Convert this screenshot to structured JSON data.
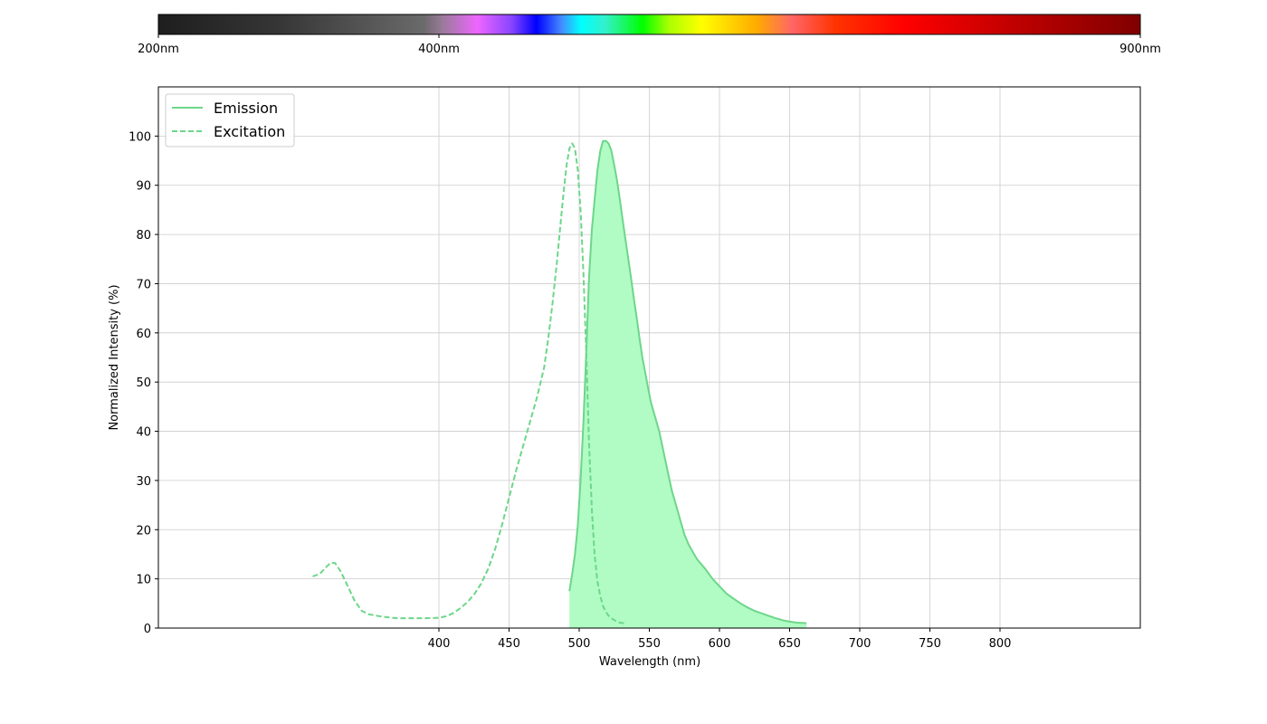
{
  "spectrum_bar": {
    "labels": [
      {
        "wavelength": 200,
        "text": "200nm"
      },
      {
        "wavelength": 400,
        "text": "400nm"
      },
      {
        "wavelength": 900,
        "text": "900nm"
      }
    ],
    "range": [
      200,
      900
    ]
  },
  "chart_data": {
    "type": "line",
    "title": "",
    "xlabel": "Wavelength (nm)",
    "ylabel": "Normalized Intensity (%)",
    "xlim": [
      200,
      900
    ],
    "ylim": [
      0,
      110
    ],
    "xticks": [
      400,
      450,
      500,
      550,
      600,
      650,
      700,
      750,
      800
    ],
    "yticks": [
      0,
      10,
      20,
      30,
      40,
      50,
      60,
      70,
      80,
      90,
      100
    ],
    "grid": true,
    "legend": "top-left",
    "series": [
      {
        "name": "Emission",
        "style": "solid",
        "color": "#6dd68a",
        "fill": "#b0fcc4",
        "x": [
          493,
          495,
          497,
          499,
          501,
          503,
          505,
          507,
          509,
          511,
          513,
          515,
          517,
          519,
          521,
          523,
          525,
          527,
          529,
          531,
          533,
          535,
          537,
          539,
          541,
          543,
          545,
          547,
          549,
          551,
          553,
          555,
          557,
          560,
          563,
          566,
          569,
          572,
          575,
          578,
          581,
          584,
          587,
          590,
          595,
          600,
          605,
          610,
          615,
          620,
          625,
          630,
          635,
          640,
          645,
          650,
          655,
          662
        ],
        "y": [
          7.5,
          11,
          15,
          21,
          30,
          42,
          56,
          71,
          81,
          87,
          93,
          97,
          99,
          99,
          98.5,
          97,
          94,
          91,
          87,
          83,
          79,
          75,
          71,
          67,
          63,
          59,
          55,
          52,
          49,
          46,
          44,
          42,
          40,
          36,
          32,
          28,
          25,
          22,
          19,
          17,
          15.5,
          14,
          13,
          12,
          10,
          8.5,
          7,
          6,
          5,
          4.2,
          3.5,
          3,
          2.5,
          2,
          1.6,
          1.3,
          1.1,
          1
        ]
      },
      {
        "name": "Excitation",
        "style": "dashed",
        "color": "#6dd68a",
        "x": [
          310,
          315,
          320,
          323,
          326,
          330,
          335,
          340,
          345,
          350,
          360,
          370,
          380,
          390,
          400,
          405,
          410,
          415,
          420,
          425,
          430,
          435,
          440,
          445,
          450,
          455,
          460,
          465,
          470,
          475,
          478,
          481,
          484,
          487,
          489,
          491,
          493,
          495,
          497,
          499,
          501,
          503,
          505,
          507,
          509,
          511,
          513,
          515,
          517,
          519,
          521,
          523,
          525,
          527,
          529,
          532
        ],
        "y": [
          10.5,
          11,
          12.5,
          13.3,
          13.2,
          11.5,
          8.5,
          5.5,
          3.5,
          2.8,
          2.3,
          2,
          2,
          2,
          2.1,
          2.4,
          3,
          4,
          5.2,
          6.8,
          9,
          12,
          16,
          21,
          26.5,
          32,
          37,
          42,
          47,
          53,
          59,
          66,
          74,
          83,
          89,
          94,
          97.5,
          98.5,
          97.5,
          93,
          85,
          72,
          56,
          38,
          24,
          15,
          9.5,
          6.5,
          4.5,
          3.3,
          2.5,
          2,
          1.6,
          1.3,
          1.1,
          1
        ]
      }
    ]
  }
}
